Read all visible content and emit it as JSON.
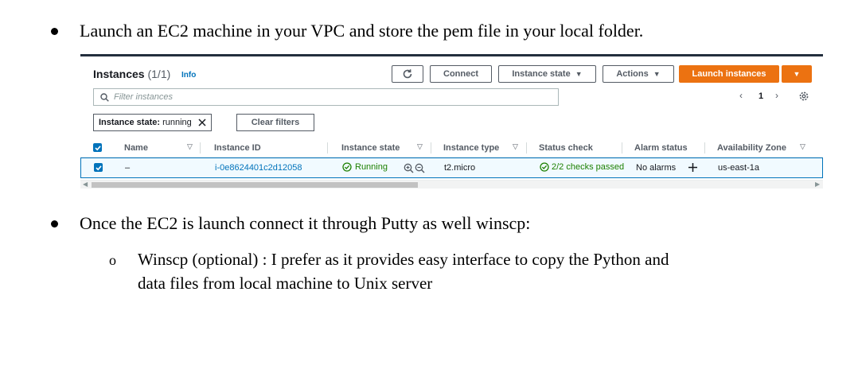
{
  "document": {
    "bullet1": "Launch an EC2 machine in your VPC and store the pem file in your local folder.",
    "bullet2": "Once the EC2 is launch connect it through Putty as well winscp:",
    "sub_bullet_marker": "o",
    "sub_bullet_line1": "Winscp (optional) : I prefer as it provides easy interface to copy the Python and",
    "sub_bullet_line2": "data files from local machine to Unix server"
  },
  "console": {
    "title": "Instances",
    "count": "(1/1)",
    "info_link": "Info",
    "buttons": {
      "connect": "Connect",
      "instance_state": "Instance state",
      "actions": "Actions",
      "launch": "Launch instances"
    },
    "search": {
      "placeholder": "Filter instances"
    },
    "pagination": {
      "current_page": "1"
    },
    "filter_chip": {
      "key": "Instance state:",
      "value": "running"
    },
    "clear_filters": "Clear filters",
    "columns": [
      "Name",
      "Instance ID",
      "Instance state",
      "Instance type",
      "Status check",
      "Alarm status",
      "Availability Zone"
    ],
    "row": {
      "name": "–",
      "instance_id": "i-0e8624401c2d12058",
      "state": "Running",
      "type": "t2.micro",
      "status_check": "2/2 checks passed",
      "alarm_status": "No alarms",
      "az": "us-east-1a"
    },
    "colors": {
      "header_bar": "#232f3e",
      "accent_orange": "#ec7211",
      "link_blue": "#0073bb",
      "success_green": "#1d8102",
      "selected_row_bg": "#f1faff"
    }
  }
}
